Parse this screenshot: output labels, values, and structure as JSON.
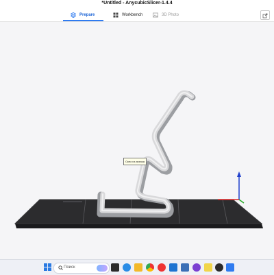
{
  "window": {
    "title": "*Untitled - AnycubicSlicer-1.4.4"
  },
  "tabs": [
    {
      "label": "Prepare",
      "icon": "cube-stack-icon",
      "active": true
    },
    {
      "label": "Workbench",
      "icon": "grid-icon",
      "active": false
    },
    {
      "label": "3D Photo",
      "icon": "photo-icon",
      "active": false
    }
  ],
  "viewport": {
    "tooltip": "Окно из значка"
  },
  "taskbar": {
    "search_placeholder": "Поиск",
    "apps": [
      "file-explorer-icon",
      "browser-icon",
      "edge-icon",
      "chrome-icon",
      "mail-icon",
      "store-icon",
      "app-icon",
      "media-icon",
      "yandex-icon",
      "slicer-icon"
    ]
  },
  "colors": {
    "accent": "#2f7bf0",
    "bed": "#2c2c2e",
    "model": "#d6d6d6",
    "axis_z": "#1f3fcc",
    "axis_x": "#d22",
    "axis_y": "#2a2"
  }
}
